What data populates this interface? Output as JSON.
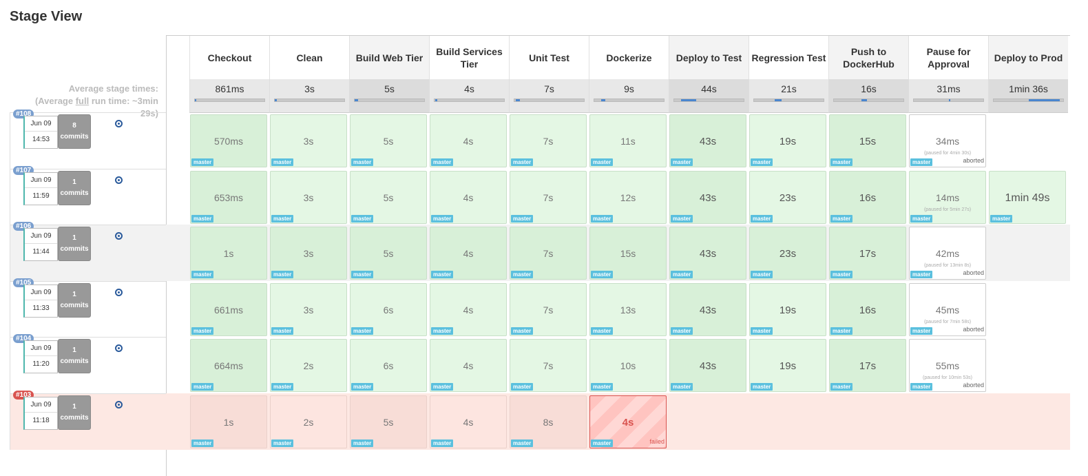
{
  "title": "Stage View",
  "avg": {
    "line1": "Average stage times:",
    "line2_pre": "(Average ",
    "line2_u": "full",
    "line2_post": " run time: ~3min",
    "line3": "29s)"
  },
  "stages": [
    {
      "name": "Checkout",
      "avg": "861ms"
    },
    {
      "name": "Clean",
      "avg": "3s"
    },
    {
      "name": "Build Web Tier",
      "avg": "5s"
    },
    {
      "name": "Build Services Tier",
      "avg": "4s"
    },
    {
      "name": "Unit Test",
      "avg": "7s"
    },
    {
      "name": "Dockerize",
      "avg": "9s"
    },
    {
      "name": "Deploy to Test",
      "avg": "44s"
    },
    {
      "name": "Regression Test",
      "avg": "21s"
    },
    {
      "name": "Push to DockerHub",
      "avg": "16s"
    },
    {
      "name": "Pause for Approval",
      "avg": "31ms"
    },
    {
      "name": "Deploy to Prod",
      "avg": "1min 36s"
    }
  ],
  "branch_tag": "master",
  "runs": [
    {
      "build": "#108",
      "date": "Jun 09",
      "time": "14:53",
      "commits": "8",
      "commits_label": "commits",
      "cells": [
        "570ms",
        "3s",
        "5s",
        "4s",
        "7s",
        "11s",
        "43s",
        "19s",
        "15s",
        "34ms",
        ""
      ],
      "pause_note": "(paused for 4min 30s)",
      "pause_status": "aborted"
    },
    {
      "build": "#107",
      "date": "Jun 09",
      "time": "11:59",
      "commits": "1",
      "commits_label": "commits",
      "cells": [
        "653ms",
        "3s",
        "5s",
        "4s",
        "7s",
        "12s",
        "43s",
        "23s",
        "16s",
        "14ms",
        "1min 49s"
      ],
      "pause_note": "(paused for 5min 27s)",
      "pause_status": ""
    },
    {
      "build": "#106",
      "date": "Jun 09",
      "time": "11:44",
      "commits": "1",
      "commits_label": "commits",
      "cells": [
        "1s",
        "3s",
        "5s",
        "4s",
        "7s",
        "15s",
        "43s",
        "23s",
        "17s",
        "42ms",
        ""
      ],
      "pause_note": "(paused for 13min 8s)",
      "pause_status": "aborted"
    },
    {
      "build": "#105",
      "date": "Jun 09",
      "time": "11:33",
      "commits": "1",
      "commits_label": "commits",
      "cells": [
        "661ms",
        "3s",
        "6s",
        "4s",
        "7s",
        "13s",
        "43s",
        "19s",
        "16s",
        "45ms",
        ""
      ],
      "pause_note": "(paused for 7min 58s)",
      "pause_status": "aborted"
    },
    {
      "build": "#104",
      "date": "Jun 09",
      "time": "11:20",
      "commits": "1",
      "commits_label": "commits",
      "cells": [
        "664ms",
        "2s",
        "6s",
        "4s",
        "7s",
        "10s",
        "43s",
        "19s",
        "17s",
        "55ms",
        ""
      ],
      "pause_note": "(paused for 10min 53s)",
      "pause_status": "aborted"
    },
    {
      "build": "#103",
      "date": "Jun 09",
      "time": "11:18",
      "commits": "1",
      "commits_label": "commits",
      "cells": [
        "1s",
        "2s",
        "5s",
        "4s",
        "8s",
        "4s",
        "",
        "",
        "",
        "",
        ""
      ],
      "failed_status": "failed"
    }
  ],
  "colors": {
    "success": "#e4f7e4",
    "failed": "#f8ddd7",
    "tag": "#5bc0de",
    "badge": "#7a9fcf",
    "badge_failed": "#d9534f"
  }
}
